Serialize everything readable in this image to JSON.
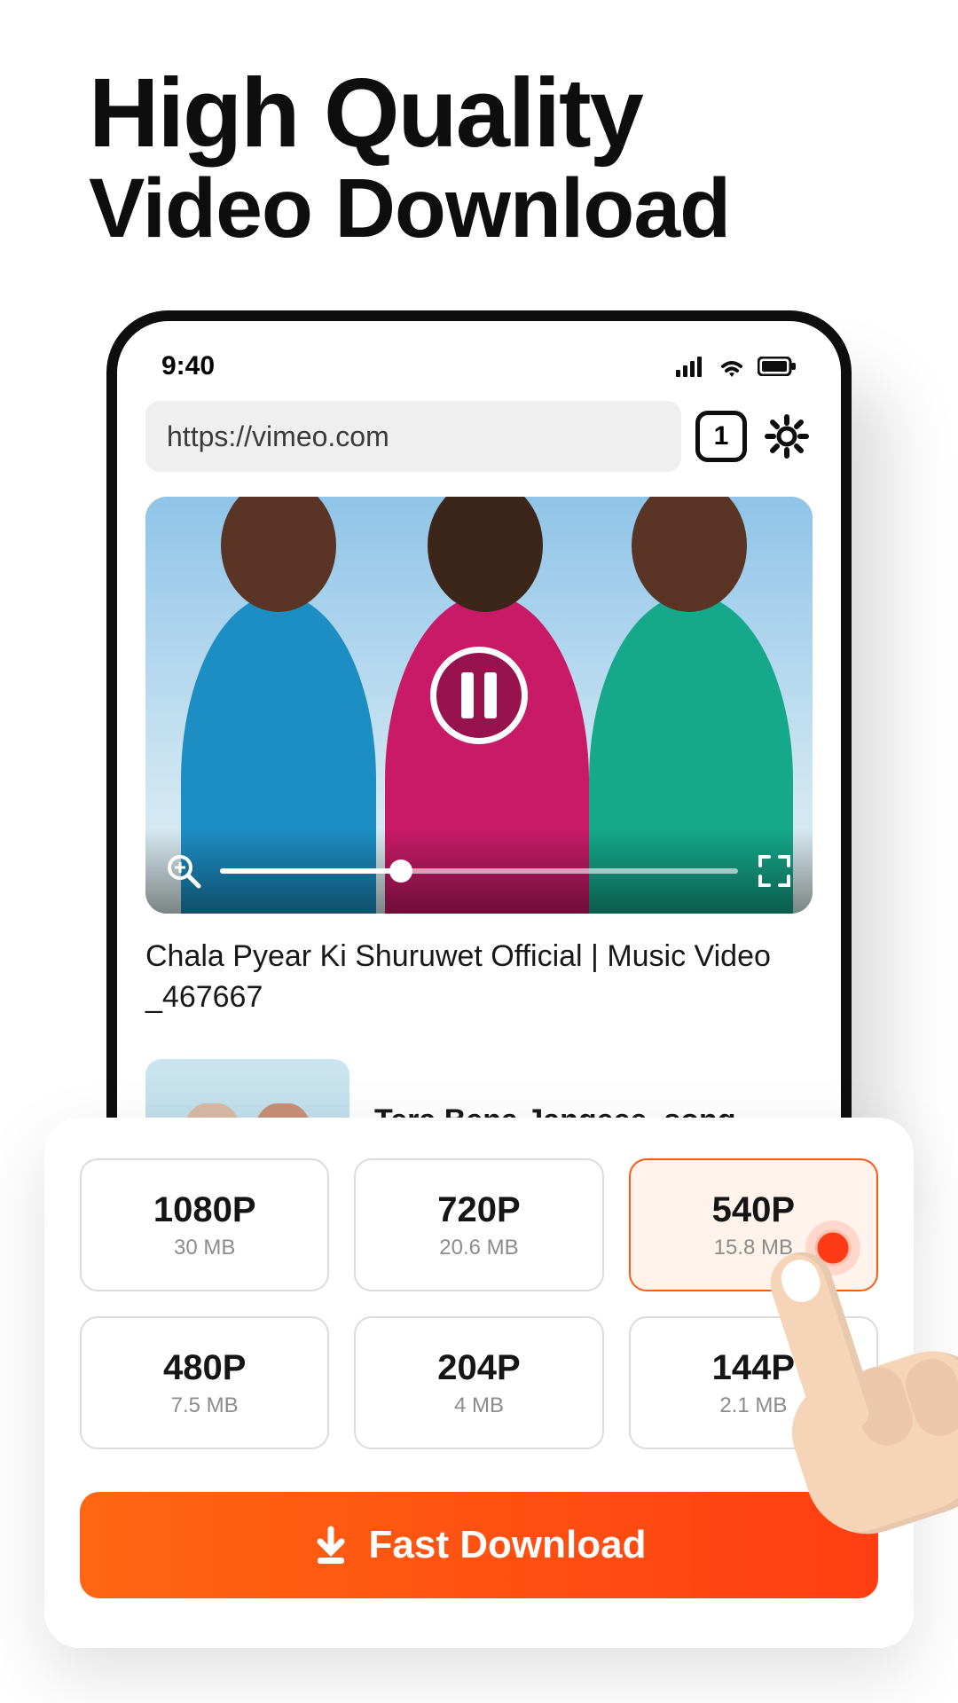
{
  "headline": {
    "line1": "High Quality",
    "line2": "Video Download"
  },
  "status": {
    "time": "9:40",
    "tab_count": "1"
  },
  "browser": {
    "url": "https://vimeo.com"
  },
  "video": {
    "title": "Chala Pyear Ki Shuruwet Official | Music Video _467667",
    "next_title": "Tera Bena Jangeee_song"
  },
  "quality_options": [
    {
      "res": "1080P",
      "size": "30 MB",
      "selected": false
    },
    {
      "res": "720P",
      "size": "20.6 MB",
      "selected": false
    },
    {
      "res": "540P",
      "size": "15.8 MB",
      "selected": true
    },
    {
      "res": "480P",
      "size": "7.5 MB",
      "selected": false
    },
    {
      "res": "204P",
      "size": "4 MB",
      "selected": false
    },
    {
      "res": "144P",
      "size": "2.1 MB",
      "selected": false
    }
  ],
  "cta": {
    "label": "Fast Download"
  },
  "colors": {
    "accent": "#ff5a12"
  }
}
